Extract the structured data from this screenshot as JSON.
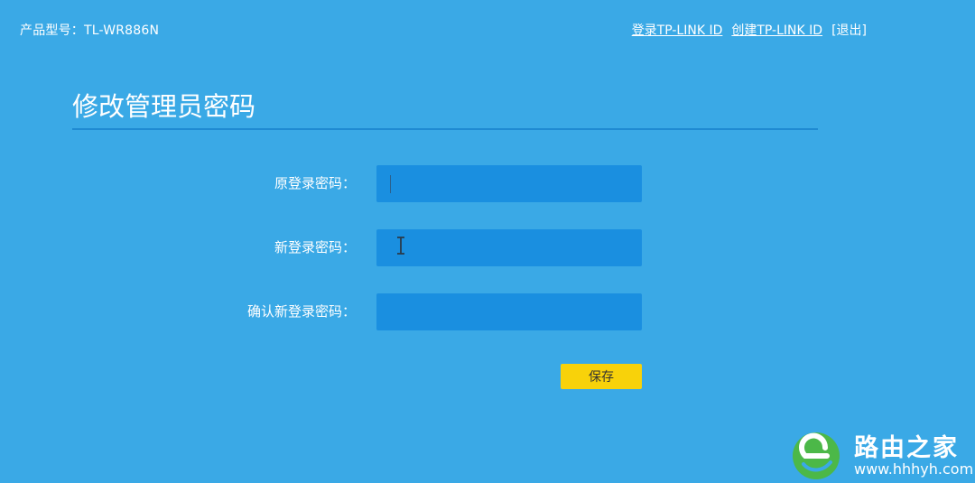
{
  "header": {
    "model_label": "产品型号：TL-WR886N",
    "links": {
      "login": "登录TP-LINK ID",
      "create": "创建TP-LINK ID",
      "logout": "[退出]"
    }
  },
  "main": {
    "title": "修改管理员密码",
    "fields": [
      {
        "label": "原登录密码：",
        "value": "",
        "placeholder": ""
      },
      {
        "label": "新登录密码：",
        "value": "",
        "placeholder": ""
      },
      {
        "label": "确认新登录密码：",
        "value": "",
        "placeholder": ""
      }
    ],
    "save_label": "保存"
  },
  "watermark": {
    "brand": "路由之家",
    "url": "www.hhhyh.com"
  },
  "colors": {
    "background": "#3aa9e6",
    "input_bg": "#1a8fe0",
    "divider": "#1f8ad2",
    "save_button": "#f8d20a",
    "logo_green": "#4cb848"
  },
  "icons": {
    "logo": "router-home-logo-icon",
    "cursor": "text-cursor-icon"
  }
}
